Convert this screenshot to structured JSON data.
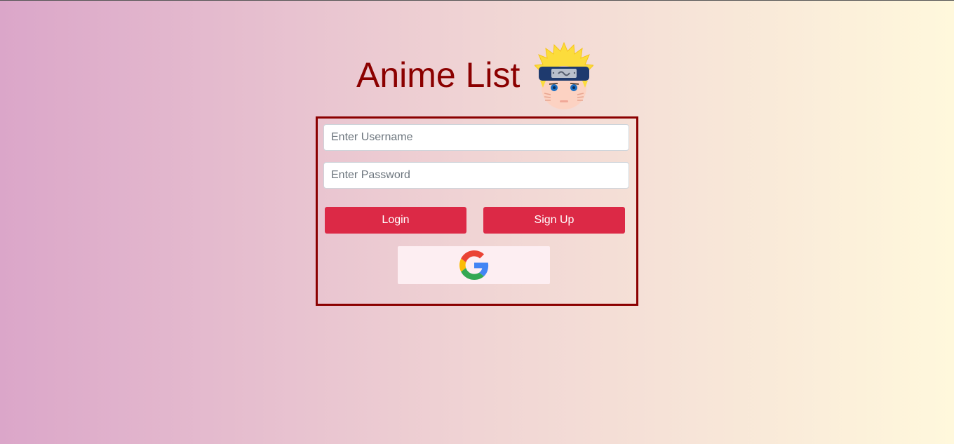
{
  "header": {
    "title": "Anime List"
  },
  "form": {
    "username_placeholder": "Enter Username",
    "password_placeholder": "Enter Password",
    "login_label": "Login",
    "signup_label": "Sign Up"
  },
  "icons": {
    "mascot": "naruto-face-icon",
    "google": "google-g-icon"
  },
  "colors": {
    "title": "#8b0000",
    "panel_border": "#8b0000",
    "button": "#dc2946",
    "google_button_bg": "#fdeef2",
    "bg_left": "#dba6c9",
    "bg_right": "#fff8dc"
  }
}
